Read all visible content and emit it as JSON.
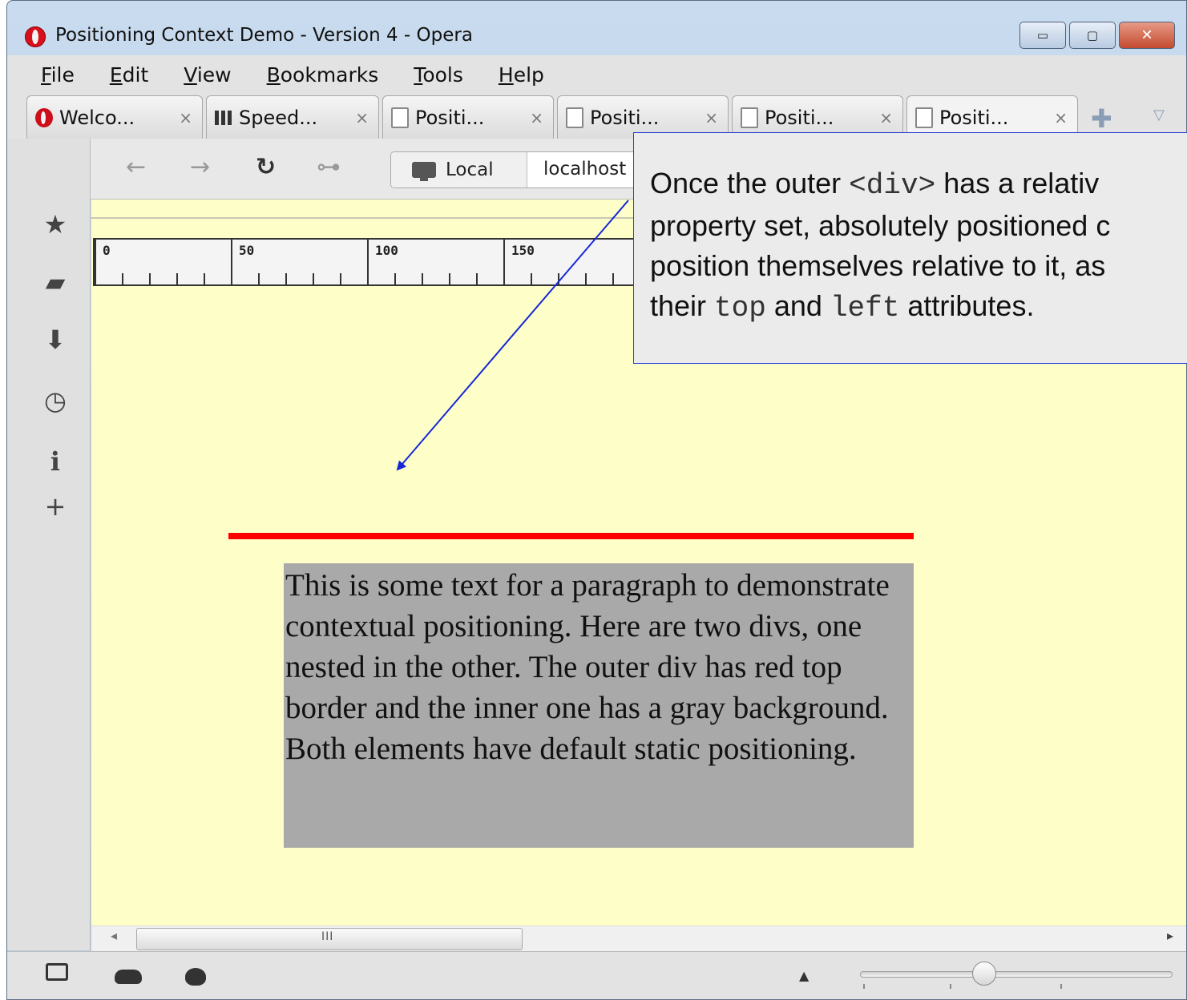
{
  "window": {
    "title": "Positioning Context Demo - Version 4 - Opera",
    "controls": {
      "minimize": "▭",
      "maximize": "▢",
      "close": "✕"
    }
  },
  "menubar": [
    "File",
    "Edit",
    "View",
    "Bookmarks",
    "Tools",
    "Help"
  ],
  "tabs": [
    {
      "label": "Welco...",
      "icon": "opera-icon",
      "close": "×"
    },
    {
      "label": "Speed...",
      "icon": "speed-dial-icon",
      "close": "×"
    },
    {
      "label": "Positi...",
      "icon": "page-icon",
      "close": "×"
    },
    {
      "label": "Positi...",
      "icon": "page-icon",
      "close": "×"
    },
    {
      "label": "Positi...",
      "icon": "page-icon",
      "close": "×"
    },
    {
      "label": "Positi...",
      "icon": "page-icon",
      "close": "×",
      "active": true
    }
  ],
  "tabbar": {
    "new_tab": "✚",
    "menu": "▽"
  },
  "navbar": {
    "back": "←",
    "forward": "→",
    "reload": "↻",
    "key": "⊶",
    "security_label": "Local",
    "url": "localhost"
  },
  "sidebar": {
    "icons": [
      "bookmarks-star-icon",
      "notes-icon",
      "downloads-icon",
      "history-clock-icon",
      "info-icon",
      "add-panel-icon"
    ],
    "glyphs": [
      "★",
      "▰",
      "⬇",
      "◷",
      "ℹ",
      "+"
    ]
  },
  "ruler": {
    "labels": [
      "0",
      "50",
      "100",
      "150"
    ]
  },
  "page": {
    "paragraph": "This is some text for a paragraph to demonstrate contextual positioning. Here are two divs, one nested in the other. The outer div has red top border and the inner one has a gray background. Both elements have default static positioning.",
    "outer_border_color": "#ff0000",
    "inner_background": "#a9a9a9",
    "page_background": "#fefec9"
  },
  "scrollbar": {
    "left_arrow": "◂",
    "right_arrow": "▸",
    "grip": "III"
  },
  "statusbar": {
    "zoom_arrow": "▲"
  },
  "callout": {
    "line1_a": "Once the outer ",
    "line1_code": "<div>",
    "line1_b": "  has a relativ",
    "line2": "property set, absolutely positioned c",
    "line3": "position themselves relative to it, as",
    "line4_a": "their ",
    "line4_code1": "top",
    "line4_b": " and ",
    "line4_code2": "left",
    "line4_c": " attributes.",
    "border_color": "#2a3ed6"
  }
}
